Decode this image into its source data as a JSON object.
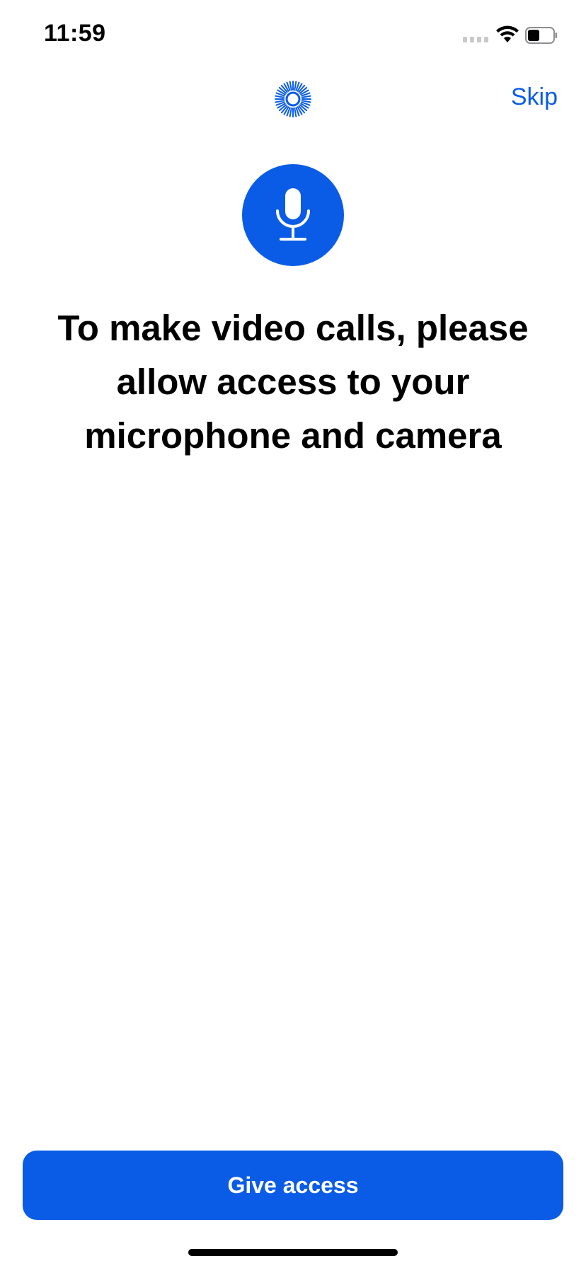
{
  "status_bar": {
    "time": "11:59",
    "icons": [
      "cellular-signal-icon",
      "wifi-icon",
      "battery-icon"
    ]
  },
  "header": {
    "logo_icon": "sunburst-logo-icon",
    "skip_label": "Skip"
  },
  "permission": {
    "icon": "microphone-icon",
    "headline": "To make video calls, please allow access to your microphone and camera"
  },
  "actions": {
    "primary_label": "Give access"
  },
  "colors": {
    "accent": "#0a5ce6",
    "background": "#ffffff",
    "text": "#000000"
  }
}
